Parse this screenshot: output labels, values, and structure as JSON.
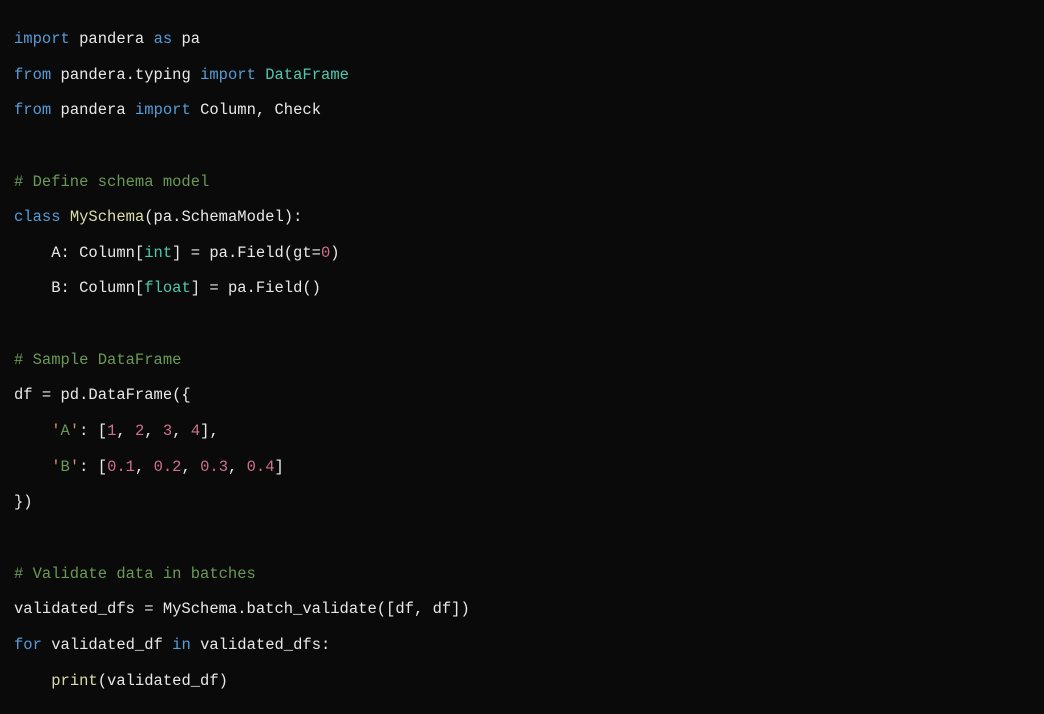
{
  "code": {
    "l1": {
      "kw1": "import",
      "m1": "pandera",
      "kw2": "as",
      "m2": "pa"
    },
    "l2": {
      "kw1": "from",
      "m1": "pandera.typing",
      "kw2": "import",
      "t1": "DataFrame"
    },
    "l3": {
      "kw1": "from",
      "m1": "pandera",
      "kw2": "import",
      "m2": "Column, Check"
    },
    "l5": {
      "c": "# Define schema model"
    },
    "l6": {
      "kw": "class",
      "name": "MySchema",
      "rest": "(pa.SchemaModel):"
    },
    "l7": {
      "pre": "    A: Column[",
      "t": "int",
      "post": "] = pa.Field(gt=",
      "n": "0",
      "end": ")"
    },
    "l8": {
      "pre": "    B: Column[",
      "t": "float",
      "post": "] = pa.Field()"
    },
    "l10": {
      "c": "# Sample DataFrame"
    },
    "l11": {
      "txt": "df = pd.DataFrame({"
    },
    "l12": {
      "pre": "    ",
      "q1": "'",
      "s": "A",
      "q2": "'",
      "mid": ": [",
      "n1": "1",
      "c1": ", ",
      "n2": "2",
      "c2": ", ",
      "n3": "3",
      "c3": ", ",
      "n4": "4",
      "end": "],"
    },
    "l13": {
      "pre": "    ",
      "q1": "'",
      "s": "B",
      "q2": "'",
      "mid": ": [",
      "n1": "0.1",
      "c1": ", ",
      "n2": "0.2",
      "c2": ", ",
      "n3": "0.3",
      "c3": ", ",
      "n4": "0.4",
      "end": "]"
    },
    "l14": {
      "txt": "})"
    },
    "l16": {
      "c": "# Validate data in batches"
    },
    "l17": {
      "txt": "validated_dfs = MySchema.batch_validate([df, df])"
    },
    "l18": {
      "kw1": "for",
      "v": "validated_df",
      "kw2": "in",
      "it": "validated_dfs:"
    },
    "l19": {
      "pre": "    ",
      "fn": "print",
      "rest": "(validated_df)"
    }
  }
}
